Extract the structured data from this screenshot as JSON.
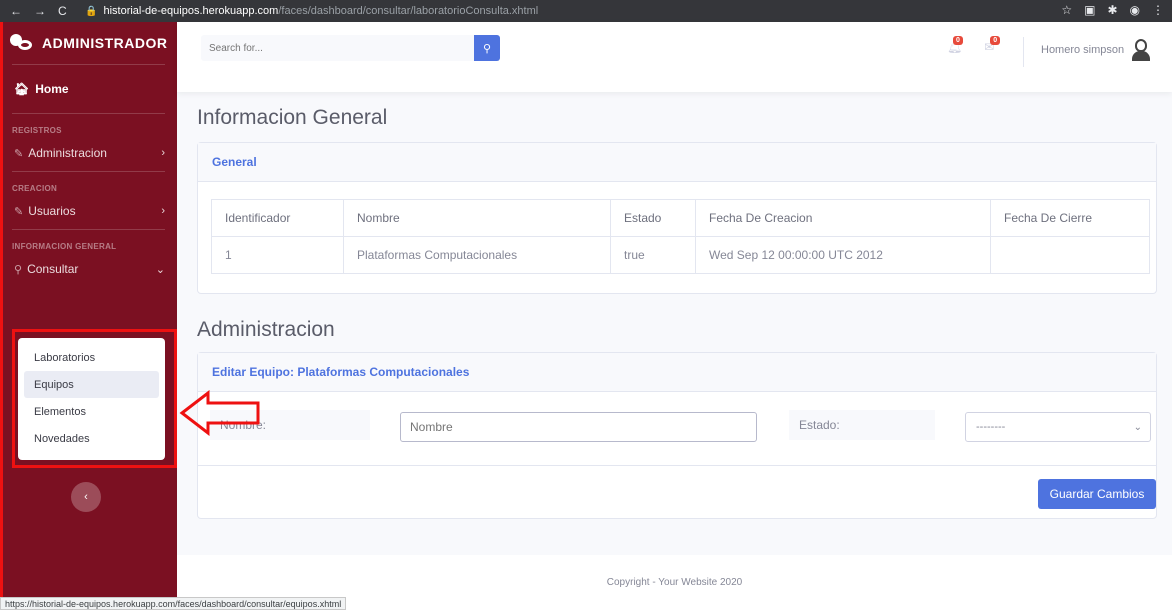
{
  "browser": {
    "host": "historial-de-equipos.herokuapp.com",
    "path": "/faces/dashboard/consultar/laboratorioConsulta.xhtml"
  },
  "sidebar": {
    "brand": "ADMINISTRADOR",
    "home": "Home",
    "heading_registros": "REGISTROS",
    "item_administracion": "Administracion",
    "heading_creacion": "CREACION",
    "item_usuarios": "Usuarios",
    "heading_info": "INFORMACION GENERAL",
    "item_consultar": "Consultar",
    "submenu": [
      "Laboratorios",
      "Equipos",
      "Elementos",
      "Novedades"
    ]
  },
  "topbar": {
    "search_placeholder": "Search for...",
    "alerts_count": "0",
    "messages_count": "0",
    "user_name": "Homero simpson"
  },
  "info_section": {
    "title": "Informacion General",
    "card_title": "General",
    "columns": [
      "Identificador",
      "Nombre",
      "Estado",
      "Fecha De Creacion",
      "Fecha De Cierre"
    ],
    "row": [
      "1",
      "Plataformas Computacionales",
      "true",
      "Wed Sep 12 00:00:00 UTC 2012",
      ""
    ]
  },
  "admin_section": {
    "title": "Administracion",
    "card_title": "Editar Equipo: Plataformas Computacionales",
    "label_nombre": "Nombre:",
    "input_nombre_placeholder": "Nombre",
    "label_estado": "Estado:",
    "select_estado_value": "--------",
    "save_label": "Guardar Cambios"
  },
  "footer": "Copyright - Your Website 2020",
  "status_url": "https://historial-de-equipos.herokuapp.com/faces/dashboard/consultar/equipos.xhtml",
  "colors": {
    "sidebar": "#7b1022",
    "primary": "#4e73df",
    "annotation": "#e11111"
  }
}
